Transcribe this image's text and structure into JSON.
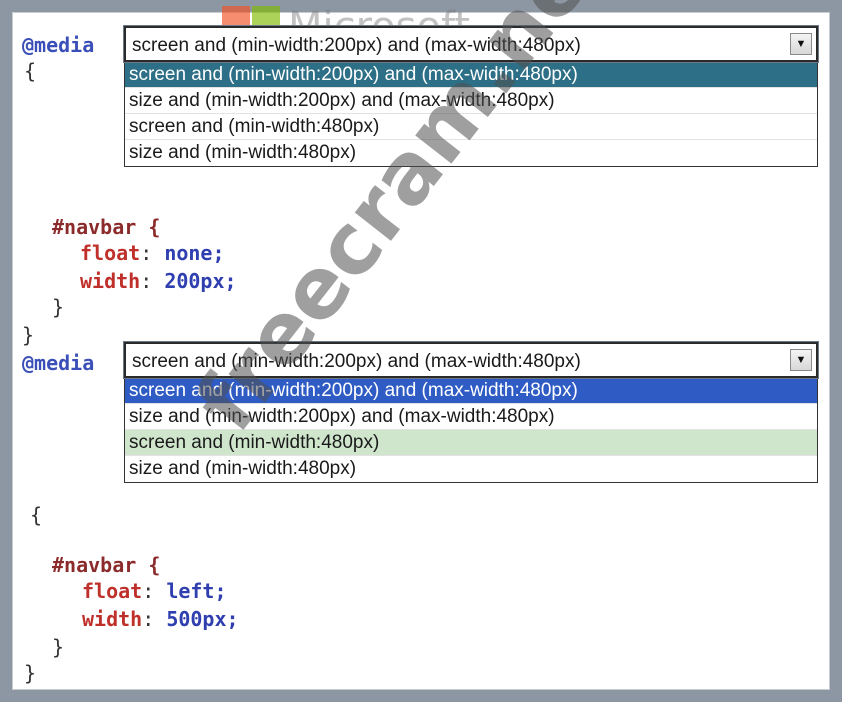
{
  "block1": {
    "at_rule": "@media",
    "open_brace": "{",
    "selector": "#navbar {",
    "prop1_name": "float",
    "prop1_value": "none;",
    "prop2_name": "width",
    "prop2_value": "200px;",
    "inner_close": "}",
    "outer_close": "}"
  },
  "dropdown1": {
    "selected": "screen and (min-width:200px) and (max-width:480px)",
    "options": [
      "screen and (min-width:200px) and (max-width:480px)",
      "size and (min-width:200px) and (max-width:480px)",
      "screen and (min-width:480px)",
      "size and (min-width:480px)"
    ]
  },
  "block2": {
    "at_rule": "@media",
    "open_brace": "{",
    "selector": "#navbar {",
    "prop1_name": "float",
    "prop1_value": "left;",
    "prop2_name": "width",
    "prop2_value": "500px;",
    "inner_close": "}",
    "outer_close": "}"
  },
  "dropdown2": {
    "selected": "screen and (min-width:200px) and (max-width:480px)",
    "options": [
      "screen and (min-width:200px) and (max-width:480px)",
      "size and (min-width:200px) and (max-width:480px)",
      "screen and (min-width:480px)",
      "size and (min-width:480px)"
    ]
  },
  "watermarks": {
    "brand": "Microsoft",
    "site": "freecram.net"
  },
  "colors": {
    "highlight_teal": "#2d6f86",
    "highlight_blue": "#2f5cc4",
    "highlight_green": "#cfe6cd"
  }
}
